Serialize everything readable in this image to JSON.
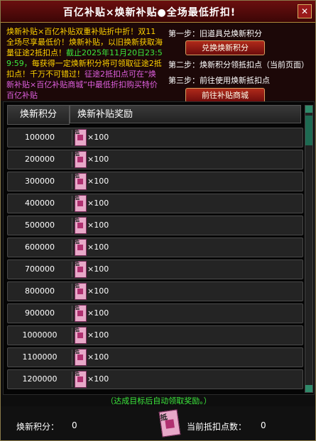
{
  "title": "百亿补贴×焕新补贴●全场最低折扣!",
  "close_label": "✕",
  "description": {
    "seg1": "焕新补贴×百亿补贴双重补贴折中折！双11全场尽享最低价！",
    "seg2": "焕新补贴，以旧换新获取海量征途2抵扣点！",
    "seg3": "截止2025年11月20日23:59:59，",
    "seg4": "每获得一定焕新积分将可领取征途2抵扣点！",
    "seg5": "千万不可错过！",
    "seg6": "征途2抵扣点可在“焕新补贴×百亿补贴商城”中最低折扣购买特价百亿补贴"
  },
  "steps": {
    "step1": "第一步：旧道具兑焕新积分",
    "step1_button": "兑换焕新积分",
    "step2": "第二步：焕新积分领抵扣点（当前页面）",
    "step3": "第三步：前往使用焕新抵扣点",
    "step3_button": "前往补贴商城"
  },
  "table": {
    "col_points": "焕新积分",
    "col_reward": "焕新补贴奖励",
    "rows": [
      {
        "points": "100000",
        "reward": "×100"
      },
      {
        "points": "200000",
        "reward": "×100"
      },
      {
        "points": "300000",
        "reward": "×100"
      },
      {
        "points": "400000",
        "reward": "×100"
      },
      {
        "points": "500000",
        "reward": "×100"
      },
      {
        "points": "600000",
        "reward": "×100"
      },
      {
        "points": "700000",
        "reward": "×100"
      },
      {
        "points": "800000",
        "reward": "×100"
      },
      {
        "points": "900000",
        "reward": "×100"
      },
      {
        "points": "1000000",
        "reward": "×100"
      },
      {
        "points": "1100000",
        "reward": "×100"
      },
      {
        "points": "1200000",
        "reward": "×100"
      }
    ]
  },
  "note": "（达成目标后自动领取奖励。）",
  "footer": {
    "points_label": "焕新积分：",
    "points_value": "0",
    "deduct_label": "当前抵扣点数：",
    "deduct_value": "0"
  },
  "icons": {
    "reward_item": "deduction-ticket-icon",
    "ticket_glyph": "抵"
  },
  "colors": {
    "accent_red": "#6b0f0f",
    "highlight_yellow": "#ffd200",
    "highlight_green": "#3ce83c",
    "highlight_pink": "#e060e0"
  }
}
